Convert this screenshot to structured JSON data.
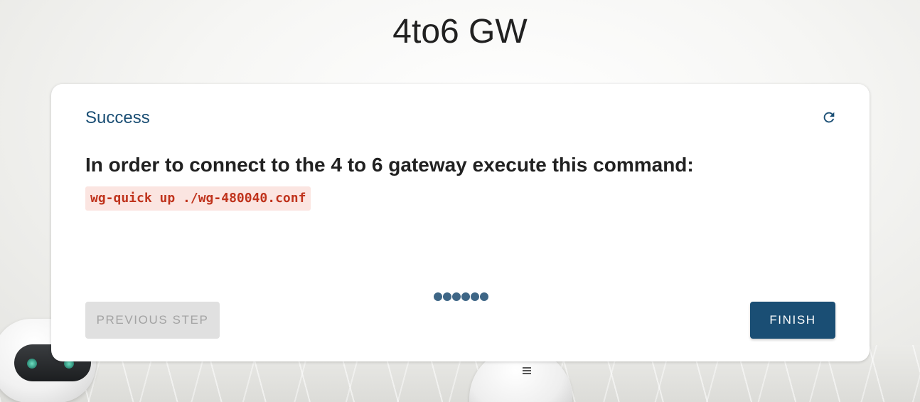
{
  "app": {
    "title": "4to6 GW"
  },
  "card": {
    "title": "Success",
    "refresh_icon": "refresh-icon",
    "instruction": "In order to connect to the 4 to 6 gateway execute this command:",
    "command": "wg-quick up ./wg-480040.conf"
  },
  "stepper": {
    "total_steps": 6
  },
  "actions": {
    "previous_label": "PREVIOUS STEP",
    "finish_label": "FINISH"
  },
  "colors": {
    "accent": "#1a4e74",
    "step_dot": "#3e6686",
    "code_text": "#c0341d",
    "code_background": "#fbe5e1",
    "disabled_button": "#e0e0e0"
  }
}
